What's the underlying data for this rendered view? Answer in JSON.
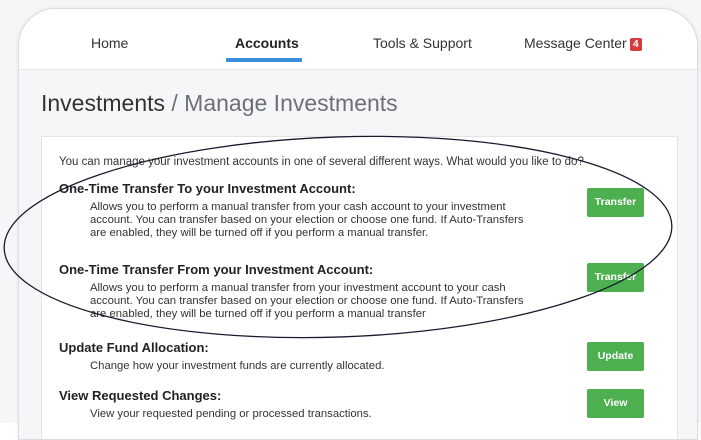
{
  "nav": {
    "items": [
      {
        "label": "Home"
      },
      {
        "label": "Accounts"
      },
      {
        "label": "Tools & Support"
      },
      {
        "label": "Message Center"
      }
    ],
    "message_count": "4"
  },
  "page": {
    "title_main": "Investments",
    "separator": " / ",
    "title_sub": "Manage Investments"
  },
  "intro": "You can manage your investment accounts in one of several different ways. What would you like to do?",
  "sections": [
    {
      "title": "One-Time Transfer To your Investment Account:",
      "description": "Allows you to perform a manual transfer from your cash account to your investment account. You can transfer based on your election or choose one fund. If Auto-Transfers are enabled, they will be turned off if you perform a manual transfer.",
      "button": "Transfer"
    },
    {
      "title": "One-Time Transfer From your Investment Account:",
      "description": "Allows you to perform a manual transfer from your investment account to your cash account. You can transfer based on your election or choose one fund. If Auto-Transfers are enabled, they will be turned off if you perform a manual transfer",
      "button": "Transfer"
    },
    {
      "title": "Update Fund Allocation:",
      "description": "Change how your investment funds are currently allocated.",
      "button": "Update"
    },
    {
      "title": "View Requested Changes:",
      "description": "View your requested pending or processed transactions.",
      "button": "View"
    }
  ],
  "colors": {
    "accent": "#3b8fd9",
    "button": "#4caf50",
    "badge": "#d93a3a"
  }
}
